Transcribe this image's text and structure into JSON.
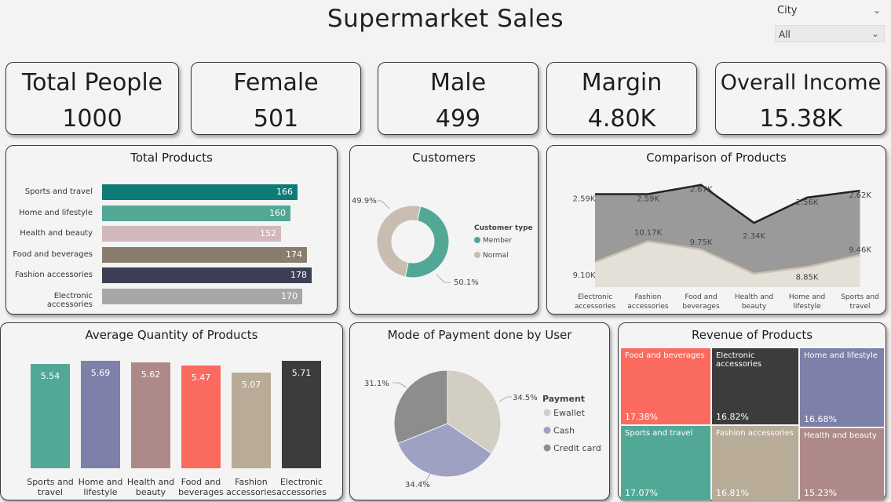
{
  "header": {
    "title": "Supermarket Sales",
    "slicer_label": "City",
    "slicer_value": "All"
  },
  "kpis": [
    {
      "label": "Total People",
      "value": "1000"
    },
    {
      "label": "Female",
      "value": "501"
    },
    {
      "label": "Male",
      "value": "499"
    },
    {
      "label": "Margin",
      "value": "4.80K"
    },
    {
      "label": "Overall Income",
      "value": "15.38K"
    }
  ],
  "total_products": {
    "title": "Total Products",
    "categories": [
      "Sports and travel",
      "Home and lifestyle",
      "Health and beauty",
      "Food and beverages",
      "Fashion accessories",
      "Electronic accessories"
    ],
    "values": [
      166,
      160,
      152,
      174,
      178,
      170
    ],
    "colors": [
      "#0f7b76",
      "#52a896",
      "#d1b8ba",
      "#8a7d6e",
      "#3d3f54",
      "#a7a7a7"
    ]
  },
  "customers": {
    "title": "Customers",
    "legend_title": "Customer type",
    "labels": [
      "Member",
      "Normal"
    ],
    "values": [
      50.1,
      49.9
    ],
    "value_labels": [
      "50.1%",
      "49.9%"
    ],
    "colors": [
      "#52a896",
      "#c8bdb0"
    ]
  },
  "comparison": {
    "title": "Comparison of Products",
    "categories": [
      [
        "Electronic",
        "accessories"
      ],
      [
        "Fashion",
        "accessories"
      ],
      [
        "Food and",
        "beverages"
      ],
      [
        "Health and",
        "beauty"
      ],
      [
        "Home and",
        "lifestyle"
      ],
      [
        "Sports and",
        "travel"
      ]
    ],
    "upper_values": [
      2.59,
      2.59,
      2.67,
      2.34,
      2.56,
      2.62
    ],
    "upper_labels": [
      "2.59K",
      "2.59K",
      "2.67K",
      "2.34K",
      "2.56K",
      "2.62K"
    ],
    "lower_values": [
      9.1,
      10.17,
      9.75,
      8.5,
      8.85,
      9.46
    ],
    "lower_labels": [
      "9.10K",
      "10.17K",
      "9.75K",
      "",
      "8.85K",
      "9.46K"
    ],
    "colors": {
      "upper_fill": "#9a9a9a",
      "lower_fill": "#e3e0d8",
      "upper_line": "#222222",
      "lower_line": "#cbbfb0"
    }
  },
  "avg_quantity": {
    "title": "Average Quantity of Products",
    "categories": [
      [
        "Sports and",
        "travel"
      ],
      [
        "Home and",
        "lifestyle"
      ],
      [
        "Health and",
        "beauty"
      ],
      [
        "Food and",
        "beverages"
      ],
      [
        "Fashion",
        "accessories"
      ],
      [
        "Electronic",
        "accessories"
      ]
    ],
    "values": [
      5.54,
      5.69,
      5.62,
      5.47,
      5.07,
      5.71
    ],
    "value_labels": [
      "5.54",
      "5.69",
      "5.62",
      "5.47",
      "5.07",
      "5.71"
    ],
    "colors": [
      "#52a896",
      "#7d80a8",
      "#ad8a87",
      "#fb6a5f",
      "#b8ab98",
      "#3c3c3c"
    ]
  },
  "payment": {
    "title": "Mode of Payment done by User",
    "legend_title": "Payment",
    "labels": [
      "Ewallet",
      "Cash",
      "Credit card"
    ],
    "values": [
      34.5,
      34.4,
      31.1
    ],
    "value_labels": [
      "34.5%",
      "34.4%",
      "31.1%"
    ],
    "colors": [
      "#d3cec3",
      "#9ea0c4",
      "#8d8d8d"
    ]
  },
  "revenue": {
    "title": "Revenue of Products",
    "tiles": [
      {
        "name": "Food and beverages",
        "pct": "17.38%",
        "color": "#fb6a5f"
      },
      {
        "name": "Electronic accessories",
        "pct": "16.82%",
        "color": "#3c3c3c"
      },
      {
        "name": "Home and lifestyle",
        "pct": "16.68%",
        "color": "#7d80a8"
      },
      {
        "name": "Sports and travel",
        "pct": "17.07%",
        "color": "#52a896"
      },
      {
        "name": "Fashion accessories",
        "pct": "16.81%",
        "color": "#b8ab98"
      },
      {
        "name": "Health and beauty",
        "pct": "15.23%",
        "color": "#ad8a87"
      }
    ]
  },
  "chart_data": [
    {
      "type": "bar",
      "title": "Total Products",
      "categories": [
        "Sports and travel",
        "Home and lifestyle",
        "Health and beauty",
        "Food and beverages",
        "Fashion accessories",
        "Electronic accessories"
      ],
      "values": [
        166,
        160,
        152,
        174,
        178,
        170
      ]
    },
    {
      "type": "pie",
      "title": "Customers",
      "labels": [
        "Member",
        "Normal"
      ],
      "values": [
        50.1,
        49.9
      ]
    },
    {
      "type": "area",
      "title": "Comparison of Products",
      "categories": [
        "Electronic accessories",
        "Fashion accessories",
        "Food and beverages",
        "Health and beauty",
        "Home and lifestyle",
        "Sports and travel"
      ],
      "series": [
        {
          "values": [
            2.59,
            2.59,
            2.67,
            2.34,
            2.56,
            2.62
          ]
        },
        {
          "values": [
            9.1,
            10.17,
            9.75,
            8.5,
            8.85,
            9.46
          ]
        }
      ]
    },
    {
      "type": "bar",
      "title": "Average Quantity of Products",
      "categories": [
        "Sports and travel",
        "Home and lifestyle",
        "Health and beauty",
        "Food and beverages",
        "Fashion accessories",
        "Electronic accessories"
      ],
      "values": [
        5.54,
        5.69,
        5.62,
        5.47,
        5.07,
        5.71
      ]
    },
    {
      "type": "pie",
      "title": "Mode of Payment done by User",
      "labels": [
        "Ewallet",
        "Cash",
        "Credit card"
      ],
      "values": [
        34.5,
        34.4,
        31.1
      ]
    },
    {
      "type": "table",
      "title": "Revenue of Products",
      "labels": [
        "Food and beverages",
        "Electronic accessories",
        "Home and lifestyle",
        "Sports and travel",
        "Fashion accessories",
        "Health and beauty"
      ],
      "values": [
        17.38,
        16.82,
        16.68,
        17.07,
        16.81,
        15.23
      ]
    }
  ]
}
